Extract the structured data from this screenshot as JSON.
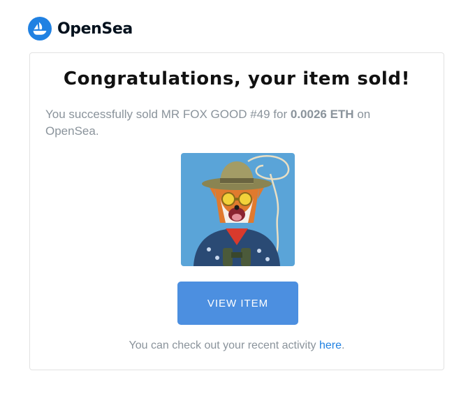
{
  "brand": {
    "name": "OpenSea",
    "logo_icon": "opensea-sailboat-icon",
    "logo_color": "#2081e2"
  },
  "email": {
    "headline": "Congratulations, your item sold!",
    "message_prefix": "You successfully sold ",
    "item_name": "MR FOX GOOD #49",
    "message_for": " for ",
    "price": "0.0026 ETH",
    "message_suffix": " on OpenSea.",
    "view_button_label": "VIEW ITEM",
    "footer_prefix": "You can check out your recent activity ",
    "footer_link": "here",
    "footer_suffix": "."
  },
  "colors": {
    "button": "#4c8fe0",
    "link": "#2081e2",
    "muted_text": "#8a939b",
    "nft_background": "#5aa4d8"
  }
}
